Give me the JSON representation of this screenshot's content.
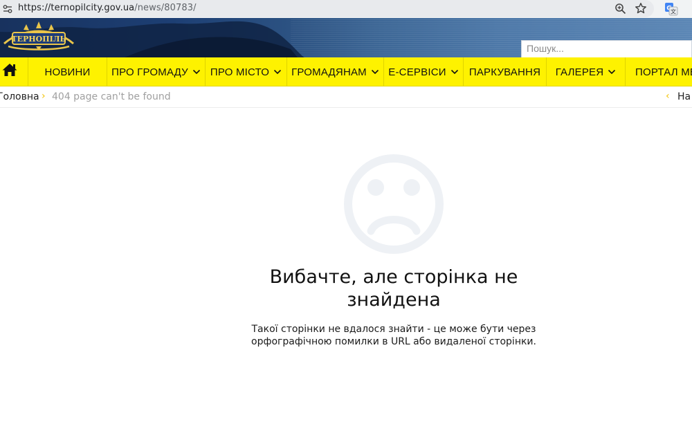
{
  "browser": {
    "url_host": "https://ternopilcity.gov.ua",
    "url_path": "/news/80783/"
  },
  "header": {
    "logo_text": "ТЕРНОПІЛЬ",
    "search_placeholder": "Пошук..."
  },
  "nav": {
    "items": [
      {
        "label": "НОВИНИ",
        "dropdown": false
      },
      {
        "label": "ПРО ГРОМАДУ",
        "dropdown": true
      },
      {
        "label": "ПРО МІСТО",
        "dropdown": true
      },
      {
        "label": "ГРОМАДЯНАМ",
        "dropdown": true
      },
      {
        "label": "Е-СЕРВІСИ",
        "dropdown": true
      },
      {
        "label": "ПАРКУВАННЯ",
        "dropdown": false
      },
      {
        "label": "ГАЛЕРЕЯ",
        "dropdown": true
      },
      {
        "label": "ПОРТАЛ МЕ",
        "dropdown": false
      }
    ]
  },
  "breadcrumb": {
    "home": "Головна",
    "current": "404 page can't be found",
    "back": "На"
  },
  "error": {
    "title": "Вибачте, але сторінка не знайдена",
    "message": "Такої сторінки не вдалося знайти - це може бути через орфографічною помилки в URL або видаленої сторінки."
  },
  "colors": {
    "nav_background": "#fef200",
    "accent": "#f2c200",
    "header_blue": "#1d3f74",
    "sad_face": "#eef1f5"
  }
}
